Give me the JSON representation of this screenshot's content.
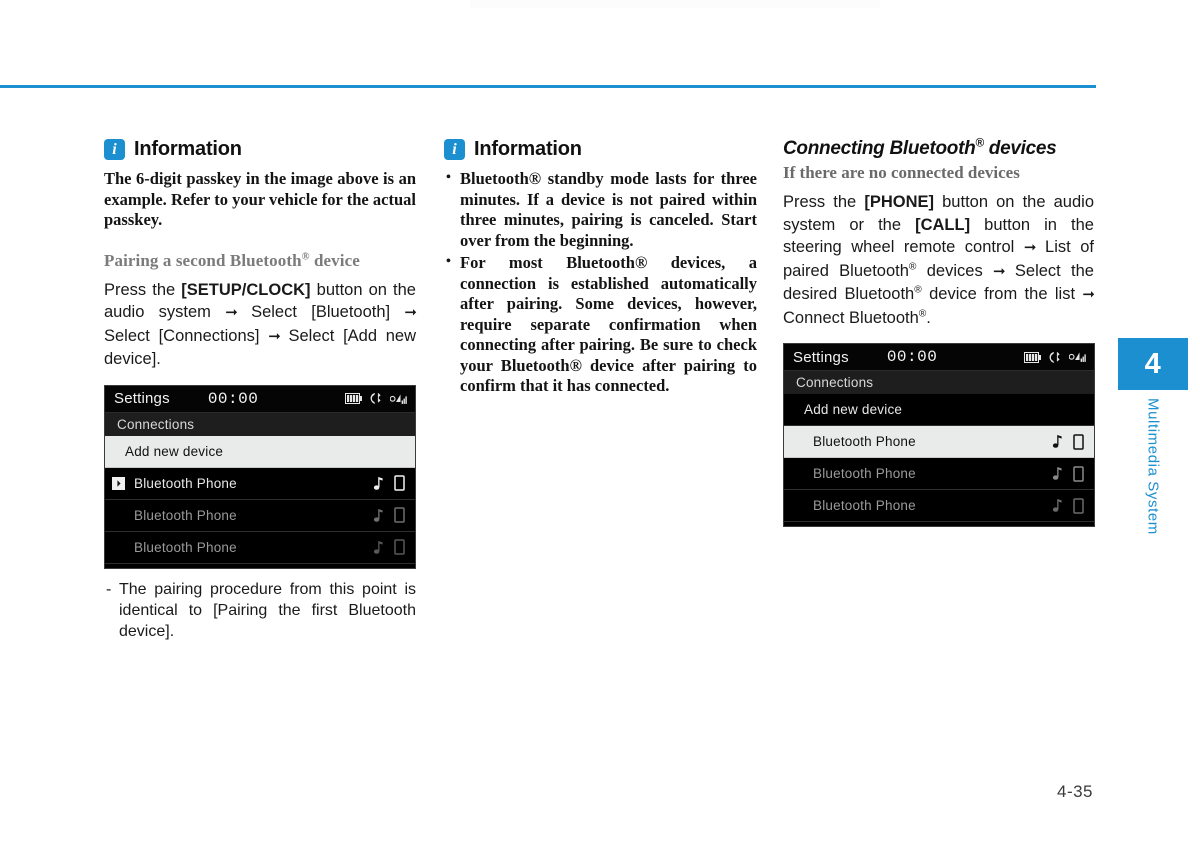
{
  "page": {
    "number": "4-35",
    "chapter_tab": "4",
    "chapter_label": "Multimedia System",
    "accent_color": "#1b8fd0"
  },
  "column_left": {
    "info": {
      "icon": "info-icon",
      "title": "Information",
      "body": "The 6-digit passkey in the image above is an example. Refer to your vehicle for the actual passkey."
    },
    "subheading": "Pairing a second Bluetooth® device",
    "steps": {
      "p1": "Press the ",
      "b1": "[SETUP/CLOCK]",
      "p2": " button on the audio system ",
      "arrow1": "⇥",
      "p3": " Select [Bluetooth] ",
      "arrow2": "⇥",
      "p4": " Select [Connections] ",
      "arrow3": "⇥",
      "p5": " Select [Add new device]."
    },
    "note": "The pairing procedure from this point is identical to [Pairing the first Bluetooth device]."
  },
  "column_mid": {
    "info": {
      "icon": "info-icon",
      "title": "Information",
      "bullets": [
        "Bluetooth® standby mode lasts for three minutes. If a device is not paired within three minutes, pairing is canceled. Start over from the beginning.",
        "For most Bluetooth® devices, a connection is established automatically after pairing. Some devices, however, require separate confirmation when connecting after pairing. Be sure to check your Bluetooth® device after pairing to confirm that it has connected."
      ]
    }
  },
  "column_right": {
    "section_title": "Connecting Bluetooth® devices",
    "subheading": "If there are no connected devices",
    "steps": {
      "p1": "Press the ",
      "b1": "[PHONE]",
      "p2": " button on the audio system or the ",
      "b2": "[CALL]",
      "p3": " button in the steering wheel remote control ",
      "arrow1": "⇥",
      "p4": " List of paired Bluetooth® devices ",
      "arrow2": "⇥",
      "p5": " Select the desired Bluetooth® device from the list ",
      "arrow3": "⇥",
      "p6": " Connect Bluetooth®."
    }
  },
  "screen_1": {
    "status": {
      "title": "Settings",
      "clock": "00:00",
      "icons": [
        "battery-icon",
        "bluetooth-phone-icon",
        "signal-strength-icon"
      ]
    },
    "breadcrumb": "Connections",
    "rows": [
      {
        "label": "Add new device",
        "state": "highlighted",
        "chevron": false,
        "icons": []
      },
      {
        "label": "Bluetooth Phone",
        "state": "active",
        "chevron": true,
        "icons": [
          "music-note-icon",
          "phone-icon"
        ]
      },
      {
        "label": "Bluetooth Phone",
        "state": "dim",
        "chevron": false,
        "icons": [
          "music-note-icon",
          "phone-icon"
        ]
      },
      {
        "label": "Bluetooth Phone",
        "state": "dim",
        "chevron": false,
        "icons": [
          "music-note-icon",
          "phone-icon"
        ]
      }
    ]
  },
  "screen_2": {
    "status": {
      "title": "Settings",
      "clock": "00:00",
      "icons": [
        "battery-icon",
        "bluetooth-phone-icon",
        "signal-strength-icon"
      ]
    },
    "breadcrumb": "Connections",
    "rows": [
      {
        "label": "Add new device",
        "state": "dark",
        "chevron": false,
        "icons": []
      },
      {
        "label": "Bluetooth Phone",
        "state": "highlighted",
        "chevron": false,
        "icons": [
          "music-note-icon",
          "phone-icon"
        ]
      },
      {
        "label": "Bluetooth Phone",
        "state": "dim",
        "chevron": false,
        "icons": [
          "music-note-icon",
          "phone-icon"
        ]
      },
      {
        "label": "Bluetooth Phone",
        "state": "dim",
        "chevron": false,
        "icons": [
          "music-note-icon",
          "phone-icon"
        ]
      }
    ]
  }
}
